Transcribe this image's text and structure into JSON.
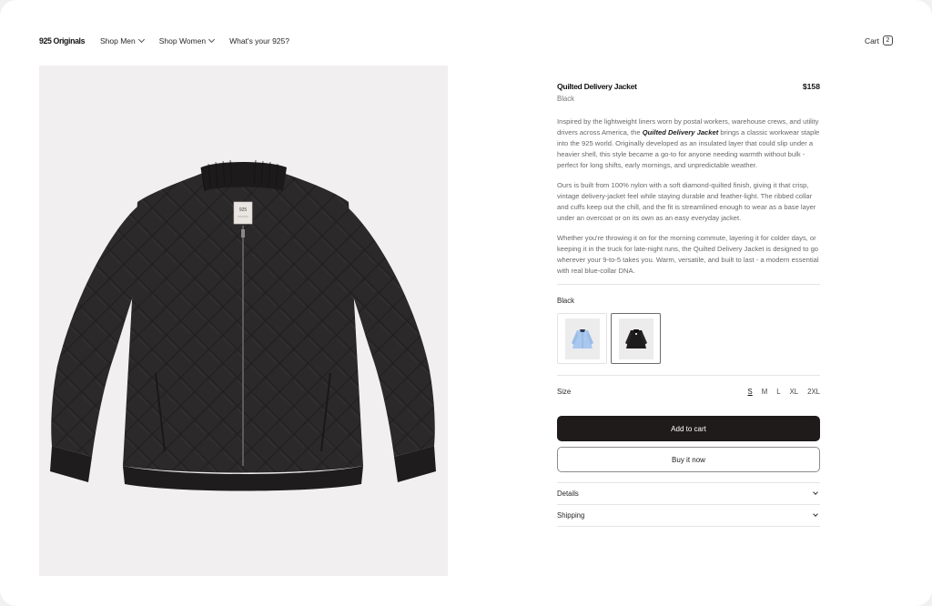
{
  "header": {
    "logo": "925 Originals",
    "nav": [
      {
        "label": "Shop Men",
        "has_dropdown": true
      },
      {
        "label": "Shop Women",
        "has_dropdown": true
      },
      {
        "label": "What's your 925?",
        "has_dropdown": false
      }
    ],
    "cart_label": "Cart",
    "cart_count": "2"
  },
  "product": {
    "title": "Quilted Delivery Jacket",
    "price": "$158",
    "variant": "Black",
    "description": {
      "p1_before": "Inspired by the lightweight liners worn by postal workers, warehouse crews, and utility drivers across America, the ",
      "p1_emphasis": "Quilted Delivery Jacket",
      "p1_after": " brings a classic workwear staple into the 925 world. Originally developed as an insulated layer that could slip under a heavier shell, this style became a go-to for anyone needing warmth without bulk - perfect for long shifts, early mornings, and unpredictable weather.",
      "p2": "Ours is built from 100% nylon with a soft diamond-quilted finish, giving it that crisp, vintage delivery-jacket feel while staying durable and feather-light. The ribbed collar and cuffs keep out the chill, and the fit is streamlined enough to wear as a base layer under an overcoat or on its own as an easy everyday jacket.",
      "p3": "Whether you're throwing it on for the morning commute, layering it for colder days, or keeping it in the truck for late-night runs, the Quilted Delivery Jacket is designed to go wherever your 9-to-5 takes you. Warm, versatile, and built to last - a modern essential with real blue-collar DNA."
    },
    "color_label": "Black",
    "swatches": [
      {
        "name": "Light Blue",
        "color": "#a9c8ef",
        "selected": false
      },
      {
        "name": "Black",
        "color": "#1d1b1c",
        "selected": true
      }
    ],
    "size_label": "Size",
    "sizes": [
      "S",
      "M",
      "L",
      "XL",
      "2XL"
    ],
    "selected_size": "S",
    "add_to_cart": "Add to cart",
    "buy_now": "Buy it now",
    "accordion": [
      "Details",
      "Shipping"
    ]
  },
  "colors": {
    "primary_button": "#1f1b1b",
    "image_bg": "#f1eff0",
    "jacket": "#2a2829"
  },
  "icons": {
    "nav_dropdown": "chevron-down-icon",
    "accordion": "chevron-down-icon"
  }
}
